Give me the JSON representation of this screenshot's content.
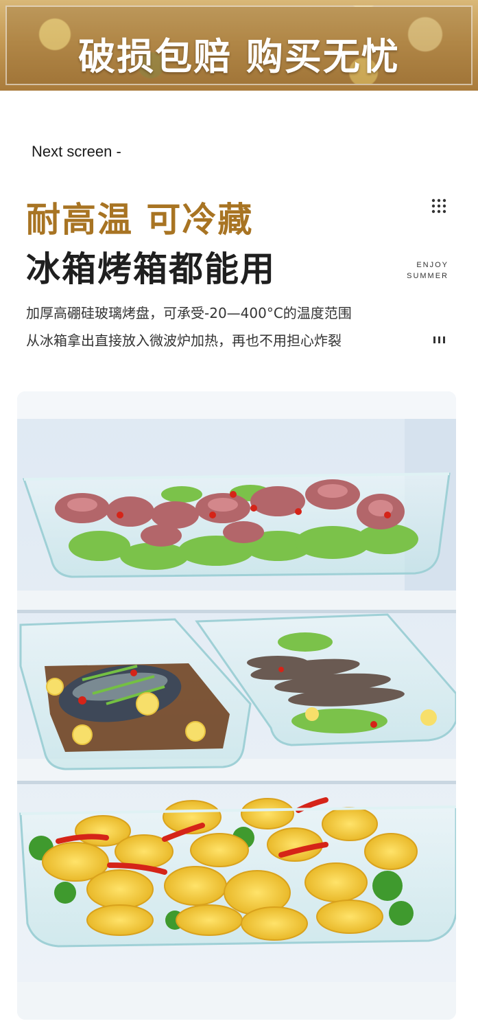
{
  "banner": {
    "title": "破损包赔  购买无忧"
  },
  "nav": {
    "next_screen": "Next screen  -"
  },
  "headline": {
    "line1": "耐高温  可冷藏",
    "line2": "冰箱烤箱都能用"
  },
  "tagline": {
    "line1": "ENJOY",
    "line2": "SUMMER"
  },
  "description": {
    "line1": "加厚高硼硅玻璃烤盘，可承受-20—400°C的温度范围",
    "line2": "从冰箱拿出直接放入微波炉加热，再也不用担心炸裂"
  },
  "icons": {
    "menu": "grid-dots-icon",
    "more": "bars-icon"
  },
  "colors": {
    "accent_gold": "#a87423",
    "banner_gold": "#c59a55",
    "headline_dark": "#1f1f1f"
  }
}
